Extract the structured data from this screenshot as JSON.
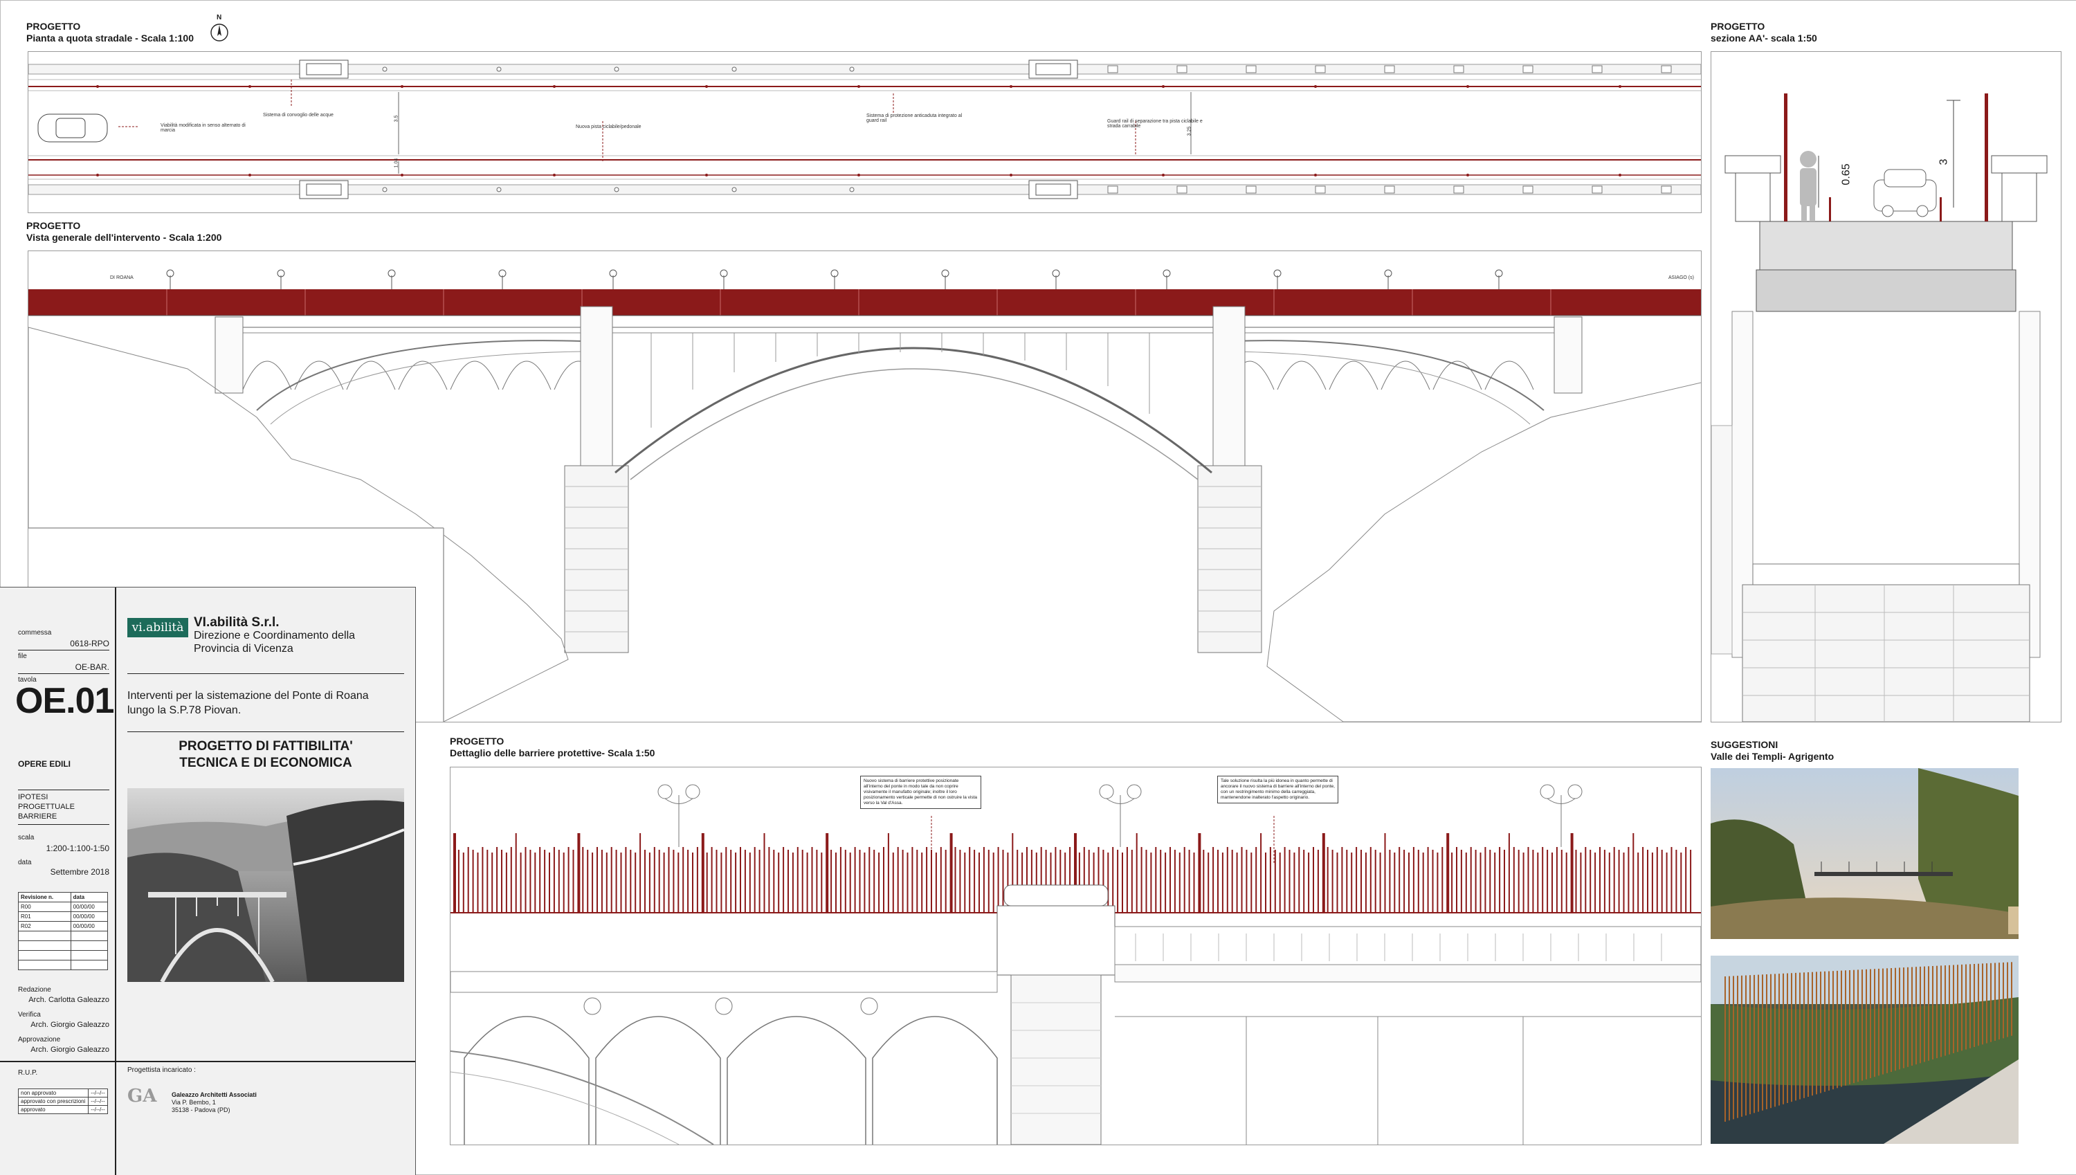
{
  "panels": {
    "plan": {
      "label": "PROGETTO",
      "subtitle": "Pianta a quota stradale - Scala 1:100"
    },
    "elevation": {
      "label": "PROGETTO",
      "subtitle": "Vista generale dell'intervento - Scala 1:200"
    },
    "section": {
      "label": "PROGETTO",
      "subtitle": "sezione AA'- scala 1:50"
    },
    "detail": {
      "label": "PROGETTO",
      "subtitle": "Dettaglio delle barriere protettive- Scala 1:50"
    },
    "suggestions": {
      "label": "SUGGESTIONI",
      "subtitle": "Valle dei Templi- Agrigento"
    }
  },
  "north_label": "N",
  "plan_notes": {
    "n1": "Sistema di convoglio delle acque",
    "n2": "Viabilità modificata in senso alternato di marcia",
    "n3": "Nuova pista ciclabile/pedonale",
    "n4": "Sistema di protezione anticaduta integrato al guard rail",
    "n5": "Guard rail di separazione tra pista ciclabile e strada carrabile",
    "dim1": "3.5",
    "dim2": "1.04",
    "dim3": "3.25"
  },
  "elevation_notes": {
    "left": "DI ROANA",
    "right": "ASIAGO (s)"
  },
  "section_dims": {
    "d1": "0.65",
    "d2": "3"
  },
  "detail_notes": {
    "note1": "Nuovo sistema di barriere protettive posizionate all'interno del ponte in modo tale da non coprire visivamente il manufatto originale; inoltre il loro posizionamento verticale permette di non ostruire la vista verso la Val d'Assa.",
    "note2": "Tale soluzione risulta la più idonea in quanto permette di ancorare il nuovo sistema di barriere all'interno del ponte, con un restringimento minimo della carreggiata, mantenendone inalterato l'aspetto originario."
  },
  "title_block": {
    "commessa_label": "commessa",
    "commessa_value": "0618-RPO",
    "file_label": "file",
    "file_value": "OE-BAR.",
    "tavola_label": "tavola",
    "tavola_value": "OE.01",
    "category": "OPERE EDILI",
    "subject": [
      "IPOTESI",
      "PROGETTUALE",
      "BARRIERE"
    ],
    "scala_label": "scala",
    "scala_value": "1:200-1:100-1:50",
    "data_label": "data",
    "data_value": "Settembre 2018",
    "rev_header": [
      "Revisione n.",
      "data"
    ],
    "revisions": [
      {
        "n": "R00",
        "date": "00/00/00"
      },
      {
        "n": "R01",
        "date": "00/00/00"
      },
      {
        "n": "R02",
        "date": "00/00/00"
      }
    ],
    "redazione_label": "Redazione",
    "redazione_value": "Arch. Carlotta Galeazzo",
    "verifica_label": "Verifica",
    "verifica_value": "Arch. Giorgio Galeazzo",
    "approvazione_label": "Approvazione",
    "approvazione_value": "Arch. Giorgio Galeazzo",
    "rup_label": "R.U.P.",
    "rup_rows": [
      {
        "label": "non approvato",
        "mark": "--/--/--"
      },
      {
        "label": "approvato con prescrizioni",
        "mark": "--/--/--"
      },
      {
        "label": "approvato",
        "mark": "--/--/--"
      }
    ],
    "logo_text": "vi.abilità",
    "company": "VI.abilità S.r.l.",
    "company_sub1": "Direzione e Coordinamento della",
    "company_sub2": "Provincia di Vicenza",
    "project_line1": "Interventi per la sistemazione del Ponte di Roana",
    "project_line2": "lungo la S.P.78 Piovan.",
    "project_title1": "PROGETTO DI FATTIBILITA'",
    "project_title2": "TECNICA E DI ECONOMICA",
    "progettista_label": "Progettista incaricato :",
    "architect_name": "Galeazzo Architetti Associati",
    "architect_addr1": "Via P. Bembo, 1",
    "architect_addr2": "35138 - Padova (PD)",
    "architect_logo": "GA"
  },
  "colors": {
    "accent_red": "#8b1a1a",
    "logo_green": "#1d6b5a",
    "line_gray": "#9a9a9a"
  }
}
